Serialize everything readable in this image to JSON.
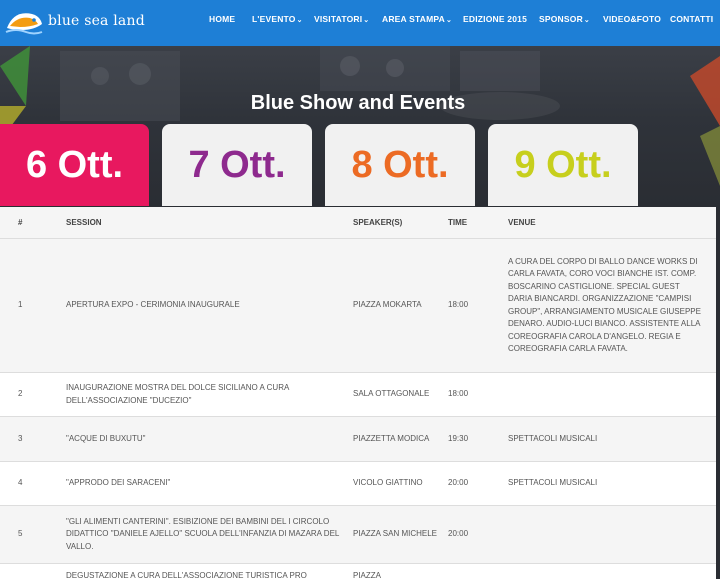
{
  "header": {
    "logo_text": "blue sea land",
    "nav": [
      {
        "label": "HOME",
        "dropdown": false
      },
      {
        "label": "L'EVENTO",
        "dropdown": true
      },
      {
        "label": "VISITATORI",
        "dropdown": true
      },
      {
        "label": "AREA STAMPA",
        "dropdown": true
      },
      {
        "label": "EDIZIONE 2015",
        "dropdown": false
      },
      {
        "label": "SPONSOR",
        "dropdown": true
      },
      {
        "label": "VIDEO&FOTO",
        "dropdown": false
      },
      {
        "label": "CONTATTI",
        "dropdown": false
      }
    ],
    "caret": "⌄"
  },
  "hero": {
    "title": "Blue Show and Events",
    "dates": [
      {
        "label": "6 Ott.",
        "active": true
      },
      {
        "label": "7 Ott.",
        "active": false
      },
      {
        "label": "8 Ott.",
        "active": false
      },
      {
        "label": "9 Ott.",
        "active": false
      }
    ]
  },
  "table": {
    "columns": [
      "#",
      "SESSION",
      "SPEAKER(S)",
      "TIME",
      "VENUE"
    ],
    "rows": [
      {
        "num": "1",
        "session": "APERTURA EXPO - CERIMONIA INAUGURALE",
        "speaker": "PIAZZA MOKARTA",
        "time": "18:00",
        "venue": "A CURA DEL CORPO DI BALLO DANCE WORKS DI CARLA FAVATA, CORO VOCI BIANCHE IST. COMP. BOSCARINO CASTIGLIONE. SPECIAL GUEST DARIA BIANCARDI. ORGANIZZAZIONE \"CAMPISI GROUP\", ARRANGIAMENTO MUSICALE GIUSEPPE DENARO. AUDIO-LUCI BIANCO. ASSISTENTE ALLA COREOGRAFIA CAROLA D'ANGELO. REGIA E COREOGRAFIA CARLA FAVATA."
      },
      {
        "num": "2",
        "session": "INAUGURAZIONE MOSTRA DEL DOLCE SICILIANO A CURA DELL'ASSOCIAZIONE \"DUCEZIO\"",
        "speaker": "SALA OTTAGONALE",
        "time": "18:00",
        "venue": ""
      },
      {
        "num": "3",
        "session": "\"ACQUE DI BUXUTU\"",
        "speaker": "PIAZZETTA MODICA",
        "time": "19:30",
        "venue": "SPETTACOLI MUSICALI"
      },
      {
        "num": "4",
        "session": "\"APPRODO DEI SARACENI\"",
        "speaker": "VICOLO GIATTINO",
        "time": "20:00",
        "venue": "SPETTACOLI MUSICALI"
      },
      {
        "num": "5",
        "session": "\"GLI ALIMENTI CANTERINI\". ESIBIZIONE DEI BAMBINI DEL I CIRCOLO DIDATTICO \"DANIELE AJELLO\" SCUOLA DELL'INFANZIA DI MAZARA DEL VALLO.",
        "speaker": "PIAZZA SAN MICHELE",
        "time": "20:00",
        "venue": ""
      },
      {
        "num": "",
        "session": "DEGUSTAZIONE A CURA DELL'ASSOCIAZIONE TURISTICA PRO",
        "speaker": "PIAZZA",
        "time": "",
        "venue": ""
      }
    ]
  },
  "colors": {
    "navbar": "#1e7fd6",
    "date1": "#e8185f",
    "date2": "#8e2a8e",
    "date3": "#ec6b24",
    "date4": "#c7cf1d"
  }
}
